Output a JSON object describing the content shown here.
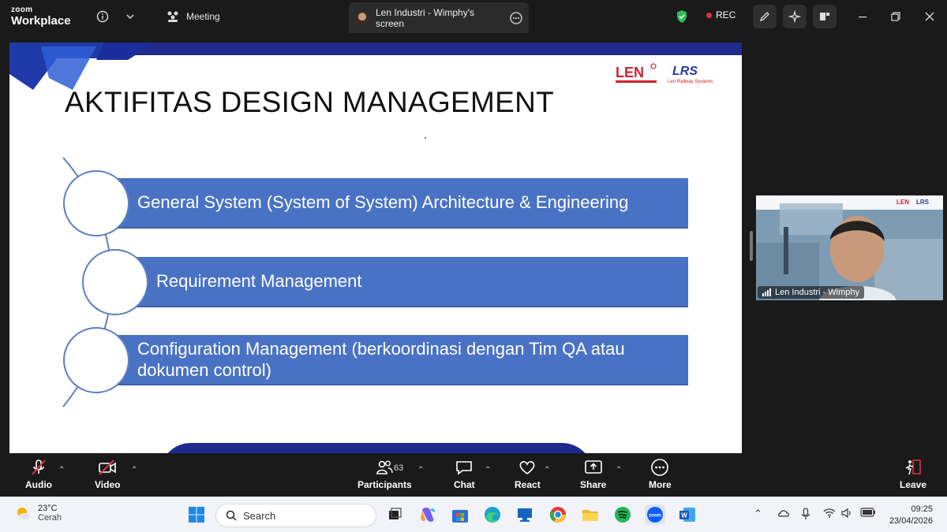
{
  "app": {
    "brand_top": "zoom",
    "brand_bottom": "Workplace",
    "meeting_label": "Meeting",
    "share_tab_label": "Len Industri - Wimphy's screen",
    "rec_label": "REC"
  },
  "slide": {
    "title": "AKTIFITAS DESIGN MANAGEMENT",
    "items": [
      "General System (System of System) Architecture & Engineering",
      "Requirement Management",
      "Configuration Management (berkoordinasi dengan Tim QA atau dokumen control)"
    ],
    "logo1_text": "LEN",
    "logo2_text": "LRS",
    "logo2_sub": "Len Railway Systems",
    "colors": {
      "bar": "#4a72c4",
      "band": "#1f2a8a"
    }
  },
  "video": {
    "participant_name": "Len Industri - Wimphy"
  },
  "toolbar": {
    "audio": "Audio",
    "video": "Video",
    "participants": "Participants",
    "participants_count": "63",
    "chat": "Chat",
    "react": "React",
    "share": "Share",
    "more": "More",
    "leave": "Leave"
  },
  "taskbar": {
    "temp": "23°C",
    "weather": "Cerah",
    "search_placeholder": "Search",
    "time": "09:25",
    "date": "23/04/2026"
  }
}
